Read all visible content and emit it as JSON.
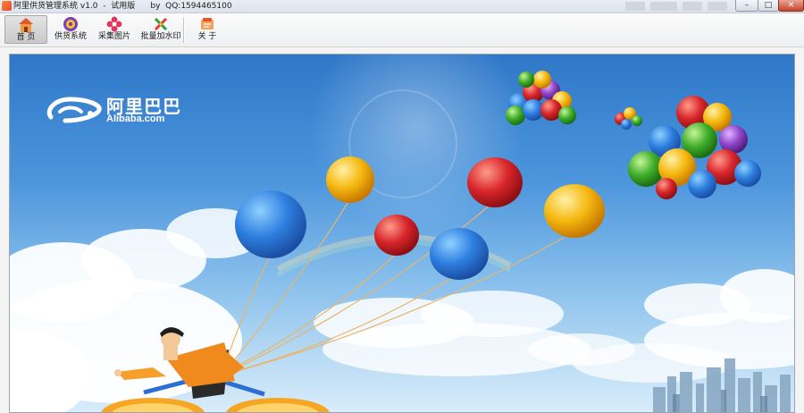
{
  "window": {
    "title": "阿里供货管理系统 v1.0  -  试用版      by  QQ:1594465100",
    "buttons": {
      "minimize": "–",
      "maximize": "□",
      "close": "✕"
    }
  },
  "toolbar": {
    "items": [
      {
        "label": "首 页",
        "icon": "home-icon",
        "active": true
      },
      {
        "label": "供货系统",
        "icon": "purple-orb-icon",
        "active": false
      },
      {
        "label": "采集图片",
        "icon": "flower-icon",
        "active": false
      },
      {
        "label": "批量加水印",
        "icon": "pencil-brush-icon",
        "active": false
      },
      {
        "label": "关  于",
        "icon": "info-card-icon",
        "active": false
      }
    ]
  },
  "banner": {
    "logo_text_cn": "阿里巴巴",
    "logo_text_en": "Alibaba.com",
    "colors": {
      "sky_top": "#2f78c8",
      "sky_bottom": "#d8ecfa",
      "balloon_blue": "#2e7fe0",
      "balloon_yellow": "#f5b80f",
      "balloon_red": "#d8262b"
    }
  }
}
